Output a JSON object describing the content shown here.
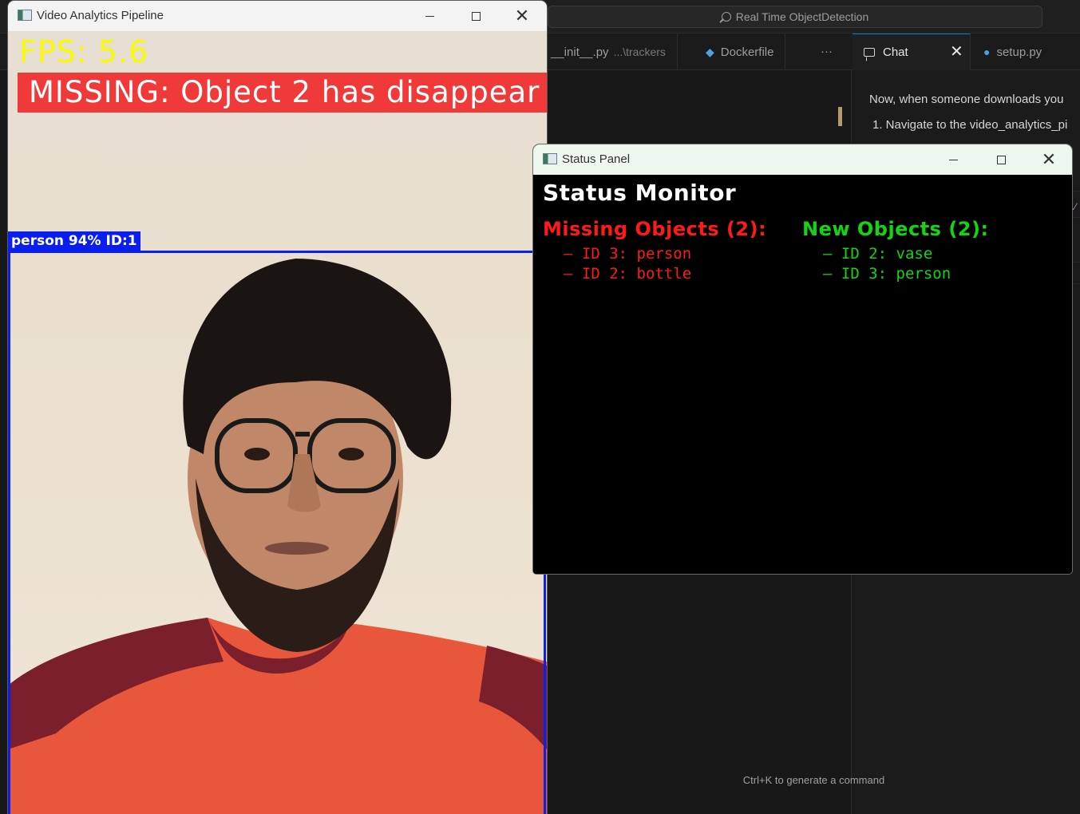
{
  "ide": {
    "search_text": "Real Time ObjectDetection",
    "tabs": [
      {
        "label": "__init__.py",
        "suffix": "...\\trackers"
      },
      {
        "label": "Dockerfile"
      },
      {
        "label": "···"
      },
      {
        "label": "Chat"
      },
      {
        "label": "setup.py"
      }
    ],
    "chat_lines": [
      "Now, when someone downloads you",
      "1. Navigate to the video_analytics_pi"
    ],
    "footer_hint": "Ctrl+K to generate a command"
  },
  "video_window": {
    "title": "Video Analytics Pipeline",
    "fps_text": "FPS: 5.6",
    "alert_text": "MISSING: Object 2 has disappear",
    "detection_label": "person 94% ID:1"
  },
  "status_window": {
    "title": "Status Panel",
    "heading": "Status Monitor",
    "missing": {
      "header": "Missing Objects (2):",
      "items": [
        "– ID 3: person",
        "– ID 2: bottle"
      ]
    },
    "new": {
      "header": "New Objects (2):",
      "items": [
        "– ID 2: vase",
        "– ID 3: person"
      ]
    }
  },
  "colors": {
    "fps": "#fafa00",
    "alert_bg": "#f03a3a",
    "box": "#0a1ef0",
    "missing": "#ff1a1a",
    "new": "#12d612"
  }
}
